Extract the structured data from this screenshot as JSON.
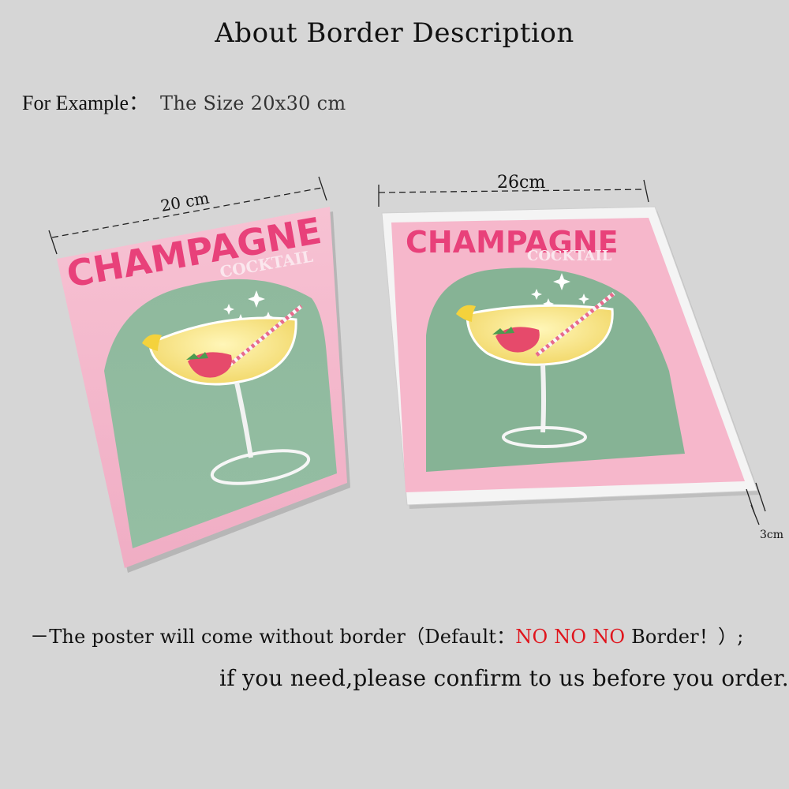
{
  "heading": "About Border Description",
  "example": {
    "label": "For Example：",
    "size_text": "The Size 20x30 cm"
  },
  "dimensions": {
    "left_width": "20 cm",
    "right_width": "26cm",
    "border": "3cm"
  },
  "poster": {
    "title": "CHAMPAGNE",
    "subtitle": "COCKTAIL",
    "colors": {
      "pink": "#f5b8cc",
      "green": "#88b397",
      "title": "#e8417a",
      "border": "#f4f4f4"
    }
  },
  "note": {
    "prefix": "－The poster will come without border（Default：",
    "warning": [
      "NO",
      "NO",
      "NO"
    ],
    "suffix": "Border！）;",
    "line2": "if you need,please confirm to us before you order."
  }
}
